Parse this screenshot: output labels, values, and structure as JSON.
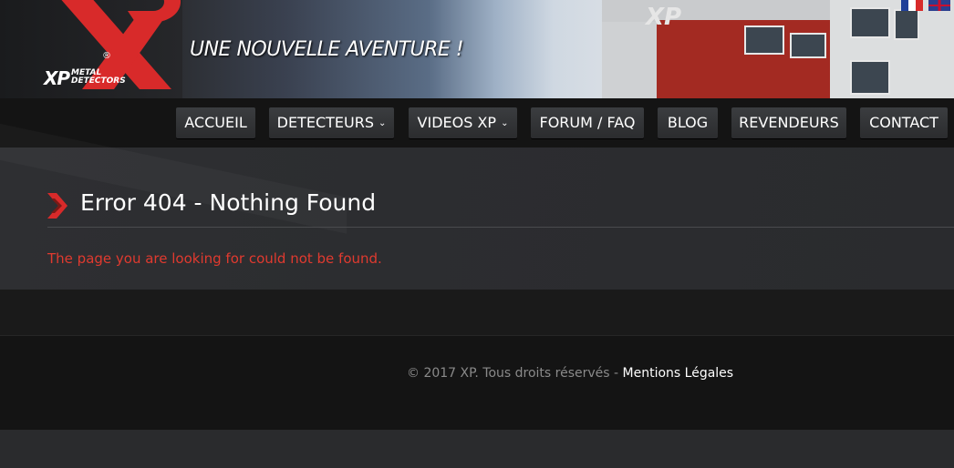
{
  "header": {
    "logo": {
      "brand": "XP",
      "subtitle": "METAL DETECTORS",
      "registered": "®"
    },
    "slogan": "UNE NOUVELLE AVENTURE !",
    "building_sign": "XP",
    "languages": [
      {
        "code": "fr",
        "icon": "flag-france-icon"
      },
      {
        "code": "en",
        "icon": "flag-uk-icon"
      }
    ]
  },
  "nav": {
    "items": [
      {
        "label": "ACCUEIL",
        "dropdown": false
      },
      {
        "label": "DETECTEURS",
        "dropdown": true
      },
      {
        "label": "VIDEOS XP",
        "dropdown": true
      },
      {
        "label": "FORUM / FAQ",
        "dropdown": false
      },
      {
        "label": "BLOG",
        "dropdown": false
      },
      {
        "label": "REVENDEURS",
        "dropdown": false
      },
      {
        "label": "CONTACT",
        "dropdown": false
      }
    ],
    "chevron": "⌄"
  },
  "main": {
    "title": "Error 404 - Nothing Found",
    "message": "The page you are looking for could not be found."
  },
  "footer": {
    "copyright": "© 2017 XP. Tous droits réservés - ",
    "legal_link": "Mentions Légales"
  },
  "colors": {
    "accent_red": "#e03a2f",
    "nav_bg": "#141414",
    "body_bg": "#2a2b2d"
  }
}
